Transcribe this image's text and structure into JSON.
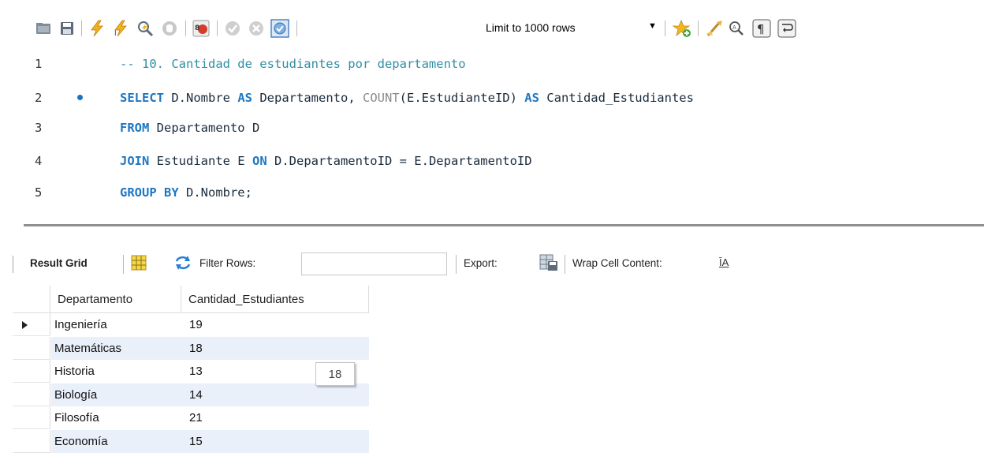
{
  "toolbar": {
    "icons": [
      "open-folder-icon",
      "save-icon",
      "execute-icon",
      "execute-current-icon",
      "explain-icon",
      "stop-icon",
      "toggle-error-icon",
      "commit-icon",
      "rollback-icon",
      "autocommit-icon"
    ],
    "limit_label": "Limit to 1000 rows",
    "right_icons": [
      "add-snippet-icon",
      "beautify-icon",
      "find-icon",
      "invisible-chars-icon",
      "wrap-icon"
    ]
  },
  "editor": {
    "lines": [
      {
        "num": "1",
        "comment": "-- 10. Cantidad de estudiantes por departamento"
      },
      {
        "num": "2",
        "k1": "SELECT",
        "t1": " D.Nombre ",
        "k2": "AS",
        "t2": " Departamento, ",
        "f1": "COUNT",
        "t3": "(E.EstudianteID) ",
        "k3": "AS",
        "t4": " Cantidad_Estudiantes"
      },
      {
        "num": "3",
        "k1": "FROM",
        "t1": " Departamento D"
      },
      {
        "num": "4",
        "k1": "JOIN",
        "t1": " Estudiante E ",
        "k2": "ON",
        "t2": " D.DepartamentoID = E.DepartamentoID"
      },
      {
        "num": "5",
        "k1": "GROUP BY",
        "t1": " D.Nombre;"
      }
    ]
  },
  "result_toolbar": {
    "result_grid": "Result Grid",
    "filter_rows": "Filter Rows:",
    "filter_value": "",
    "export": "Export:",
    "wrap": "Wrap Cell Content:"
  },
  "grid": {
    "columns": [
      "Departamento",
      "Cantidad_Estudiantes"
    ],
    "rows": [
      [
        "Ingeniería",
        "19"
      ],
      [
        "Matemáticas",
        "18"
      ],
      [
        "Historia",
        "13"
      ],
      [
        "Biología",
        "14"
      ],
      [
        "Filosofía",
        "21"
      ],
      [
        "Economía",
        "15"
      ]
    ]
  },
  "tooltip": "18",
  "colors": {
    "keyword": "#1c77c3",
    "comment": "#2f8ea5",
    "function": "#8b8b8b",
    "alt_row": "#e9f0fa"
  }
}
